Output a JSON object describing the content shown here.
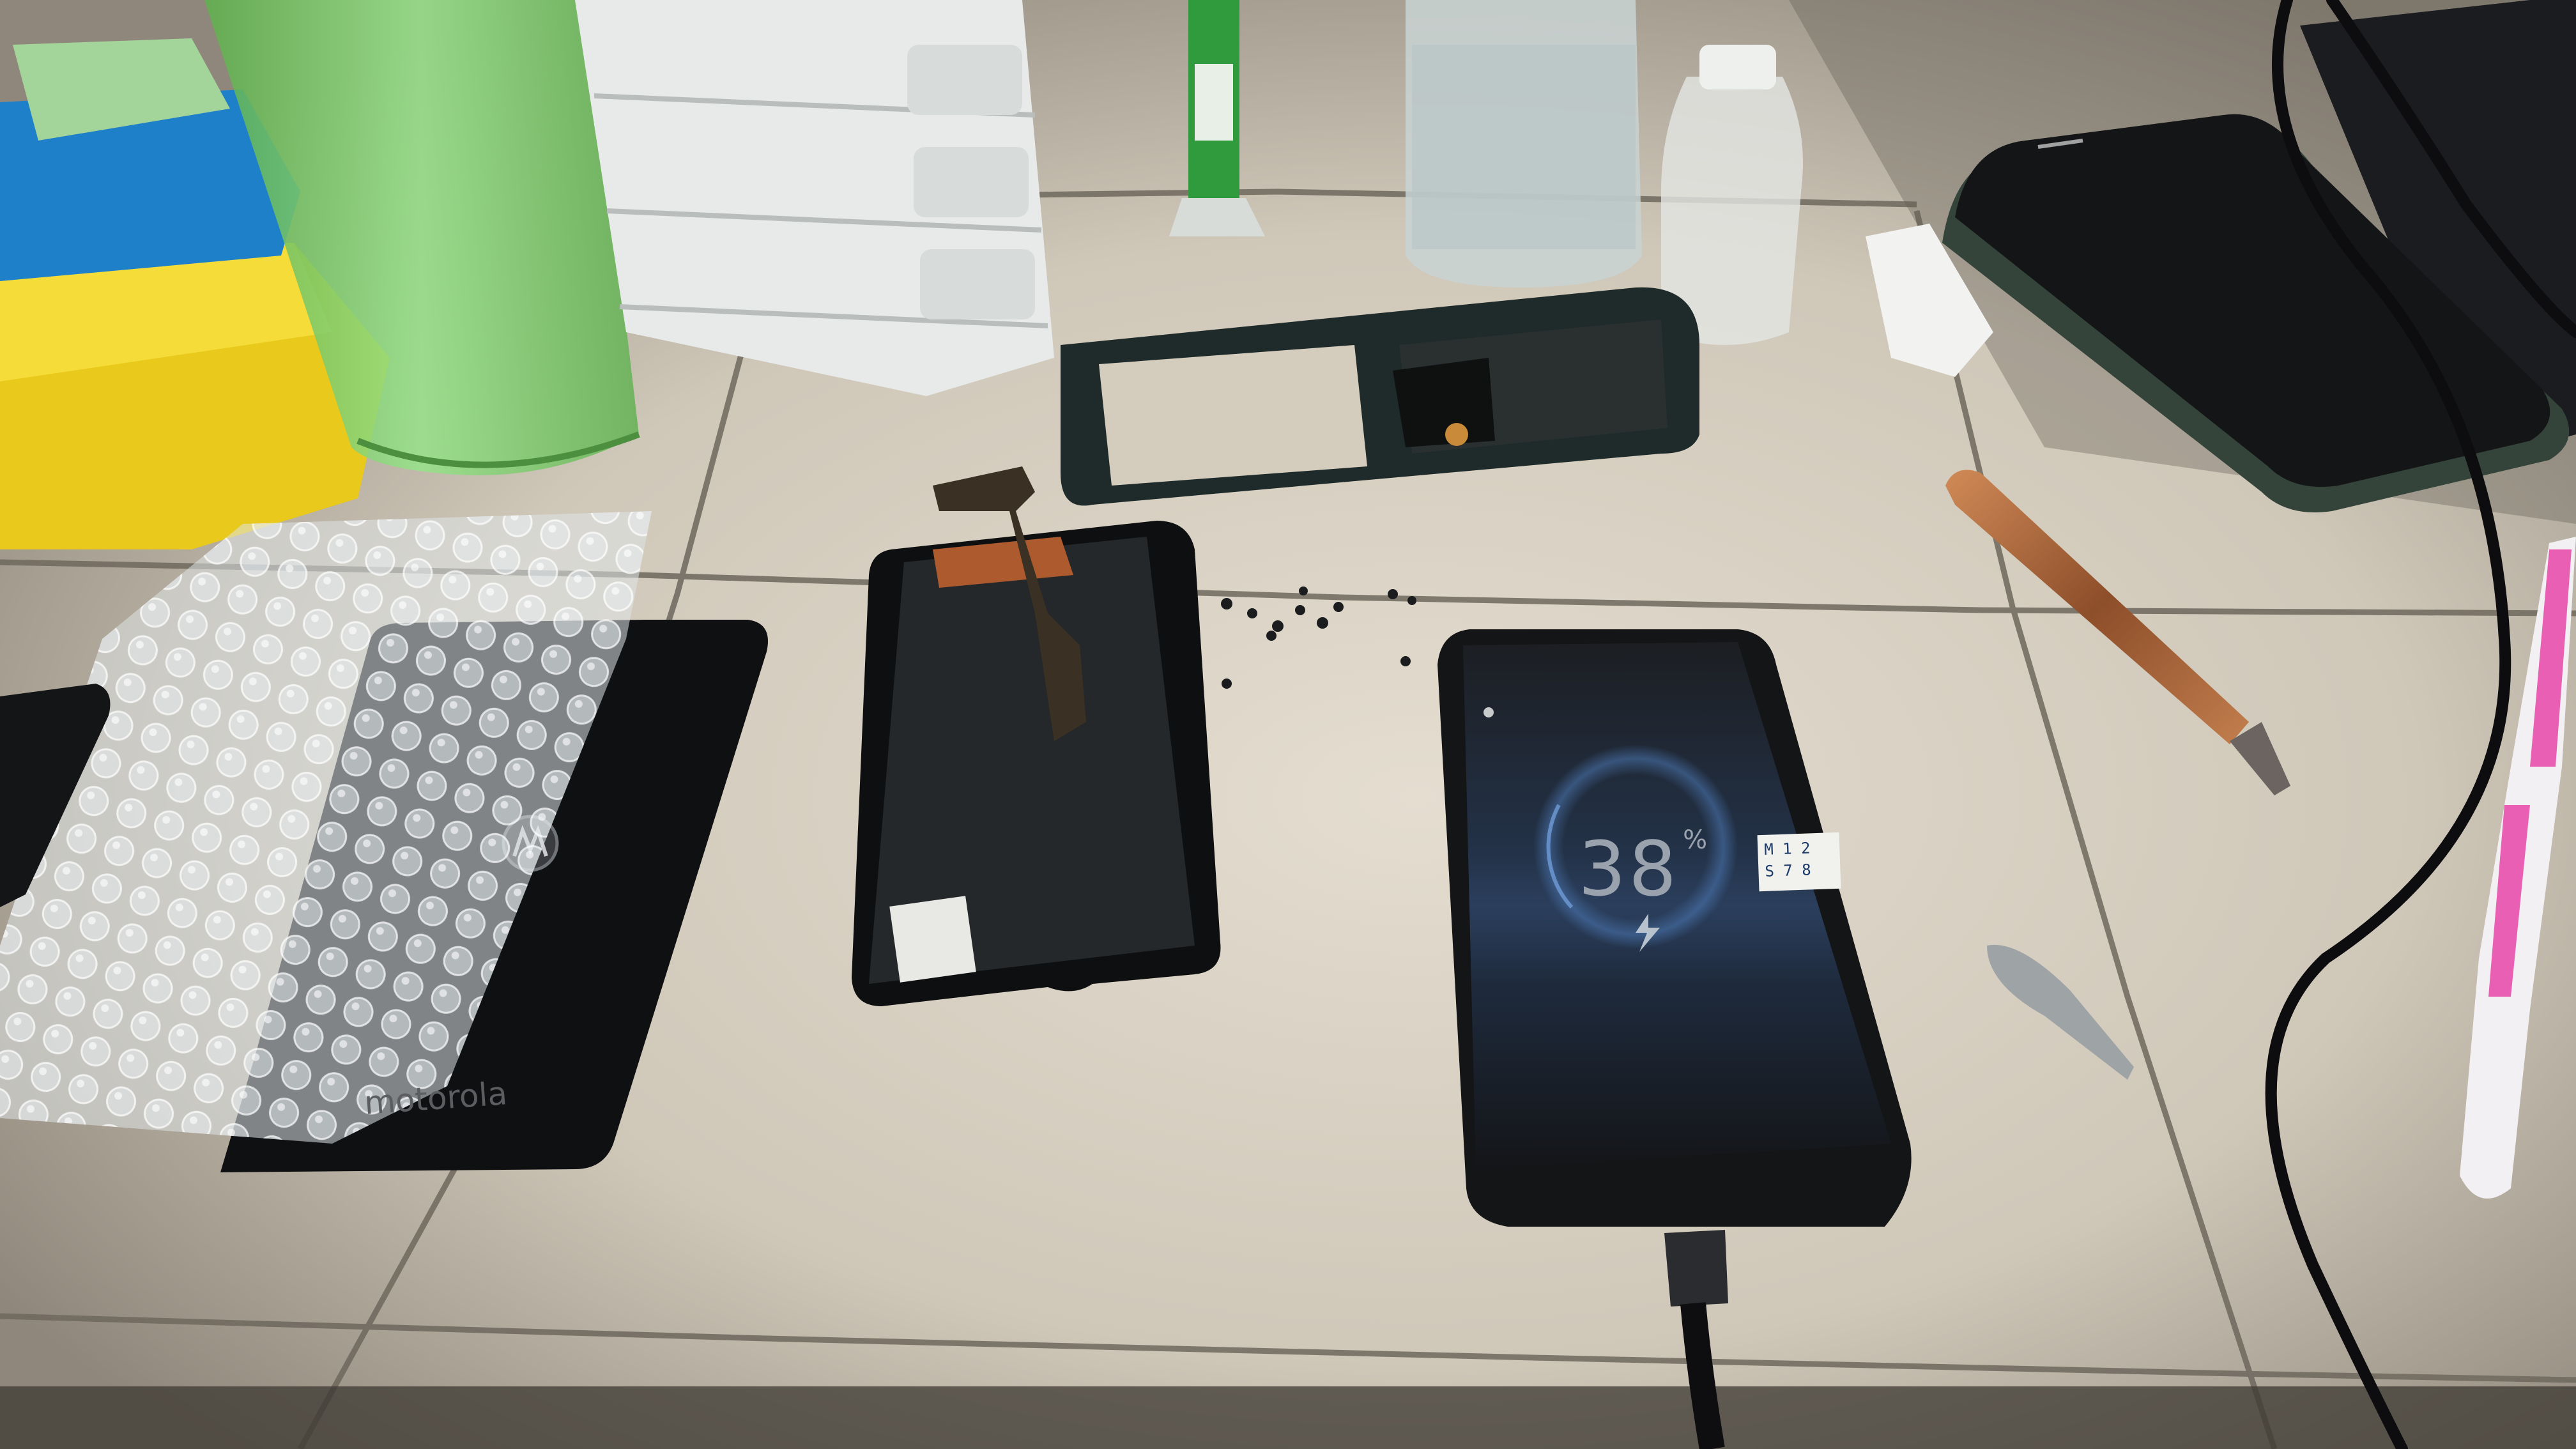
{
  "scene": {
    "description_free": true,
    "colors": {
      "tile": "#d7d0c3",
      "grout": "#6e675d",
      "phone_black": "#131416",
      "screen_glow": "#3e5c86",
      "green_cup": "#7fd46a",
      "yellow_tray": "#f2d51e",
      "copper_tool": "#b06a3e"
    }
  },
  "phone_screen": {
    "battery_value": "38",
    "battery_unit": "%",
    "charging_icon": "lightning-bolt-icon"
  },
  "back_cover": {
    "logo_text": "motorola",
    "logo_icon": "motorola-batwing-icon"
  },
  "sticker": {
    "row1": "M 1 2",
    "row2": "S 7 8"
  }
}
